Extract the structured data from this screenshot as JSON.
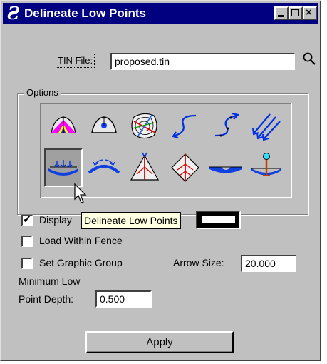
{
  "window": {
    "title": "Delineate Low Points",
    "app_icon": "geopak-icon"
  },
  "tin_file": {
    "label": "TIN File:",
    "value": "proposed.tin",
    "browse_icon": "magnifier-icon"
  },
  "options": {
    "label": "Options",
    "tools": [
      {
        "name": "color-triangles-tool"
      },
      {
        "name": "low-point-triangle-tool"
      },
      {
        "name": "contour-map-tool"
      },
      {
        "name": "flow-arrow-tool"
      },
      {
        "name": "flow-arrow-dotted-tool"
      },
      {
        "name": "parallel-flow-arrows-tool"
      },
      {
        "name": "delineate-low-points-tool",
        "selected": true
      },
      {
        "name": "delineate-high-points-tool"
      },
      {
        "name": "ridge-lines-tool"
      },
      {
        "name": "drainage-divide-tool"
      },
      {
        "name": "sump-tool"
      },
      {
        "name": "pond-marker-tool"
      }
    ]
  },
  "display": {
    "label": "Display",
    "checked": true,
    "tooltip": "Delineate Low Points"
  },
  "load_within_fence": {
    "label": "Load Within Fence",
    "checked": false
  },
  "set_graphic_group": {
    "label": "Set Graphic Group",
    "checked": false
  },
  "arrow_size": {
    "label": "Arrow Size:",
    "value": "20.000"
  },
  "min_low_point": {
    "label_line1": "Minimum Low",
    "label_line2": "Point Depth:",
    "value": "0.500"
  },
  "apply_button": {
    "label": "Apply"
  }
}
